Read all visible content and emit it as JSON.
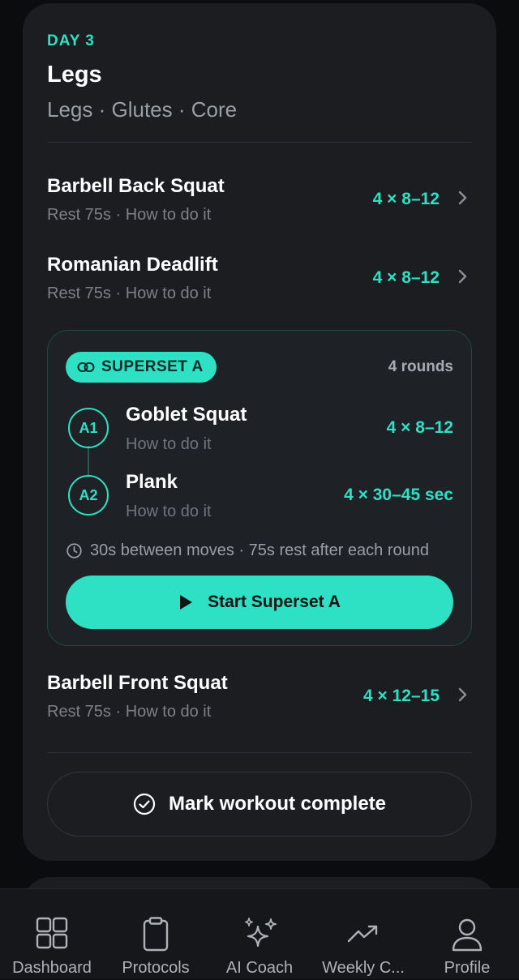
{
  "colors": {
    "accent": "#2ee0c4",
    "card": "#1b1d21",
    "background": "#0b0c0e"
  },
  "header": {
    "day": "DAY 3",
    "title": "Legs",
    "subtitle": "Legs · Glutes · Core"
  },
  "exercises": [
    {
      "name": "Barbell Back Squat",
      "sub": "Rest 75s · How to do it",
      "sets": "4 × 8–12"
    },
    {
      "name": "Romanian Deadlift",
      "sub": "Rest 75s · How to do it",
      "sets": "4 × 8–12"
    },
    {
      "name": "Barbell Front Squat",
      "sub": "Rest 75s · How to do it",
      "sets": "4 × 12–15"
    }
  ],
  "superset": {
    "badge": "SUPERSET A",
    "rounds": "4 rounds",
    "items": [
      {
        "step": "A1",
        "name": "Goblet Squat",
        "sub": "How to do it",
        "sets": "4 × 8–12"
      },
      {
        "step": "A2",
        "name": "Plank",
        "sub": "How to do it",
        "sets": "4 × 30–45 sec"
      }
    ],
    "note": "30s between moves · 75s rest after each round",
    "start_label": "Start Superset A"
  },
  "complete_label": "Mark workout complete",
  "nav": [
    {
      "label": "Dashboard",
      "icon": "grid-icon"
    },
    {
      "label": "Protocols",
      "icon": "clipboard-icon"
    },
    {
      "label": "AI Coach",
      "icon": "sparkles-icon"
    },
    {
      "label": "Weekly C...",
      "icon": "trending-up-icon"
    },
    {
      "label": "Profile",
      "icon": "user-icon"
    }
  ]
}
